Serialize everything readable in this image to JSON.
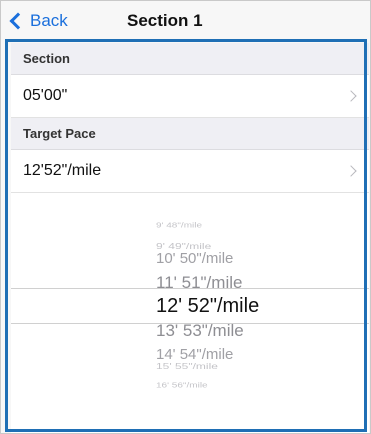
{
  "nav": {
    "back_label": "Back",
    "title": "Section 1"
  },
  "sections": [
    {
      "header": "Section",
      "value": "05'00\""
    },
    {
      "header": "Target Pace",
      "value": "12'52\"/mile"
    }
  ],
  "picker": {
    "items": [
      "9' 48\"/mile",
      "9' 49\"/mile",
      "10' 50\"/mile",
      "11' 51\"/mile",
      "12'  52\"/mile",
      "13' 53\"/mile",
      "14' 54\"/mile",
      "15' 55\"/mile",
      "16' 56\"/mile"
    ],
    "selected_index": 4
  },
  "colors": {
    "accent": "#1a6fdc",
    "highlight_border": "#1f6fb5"
  }
}
